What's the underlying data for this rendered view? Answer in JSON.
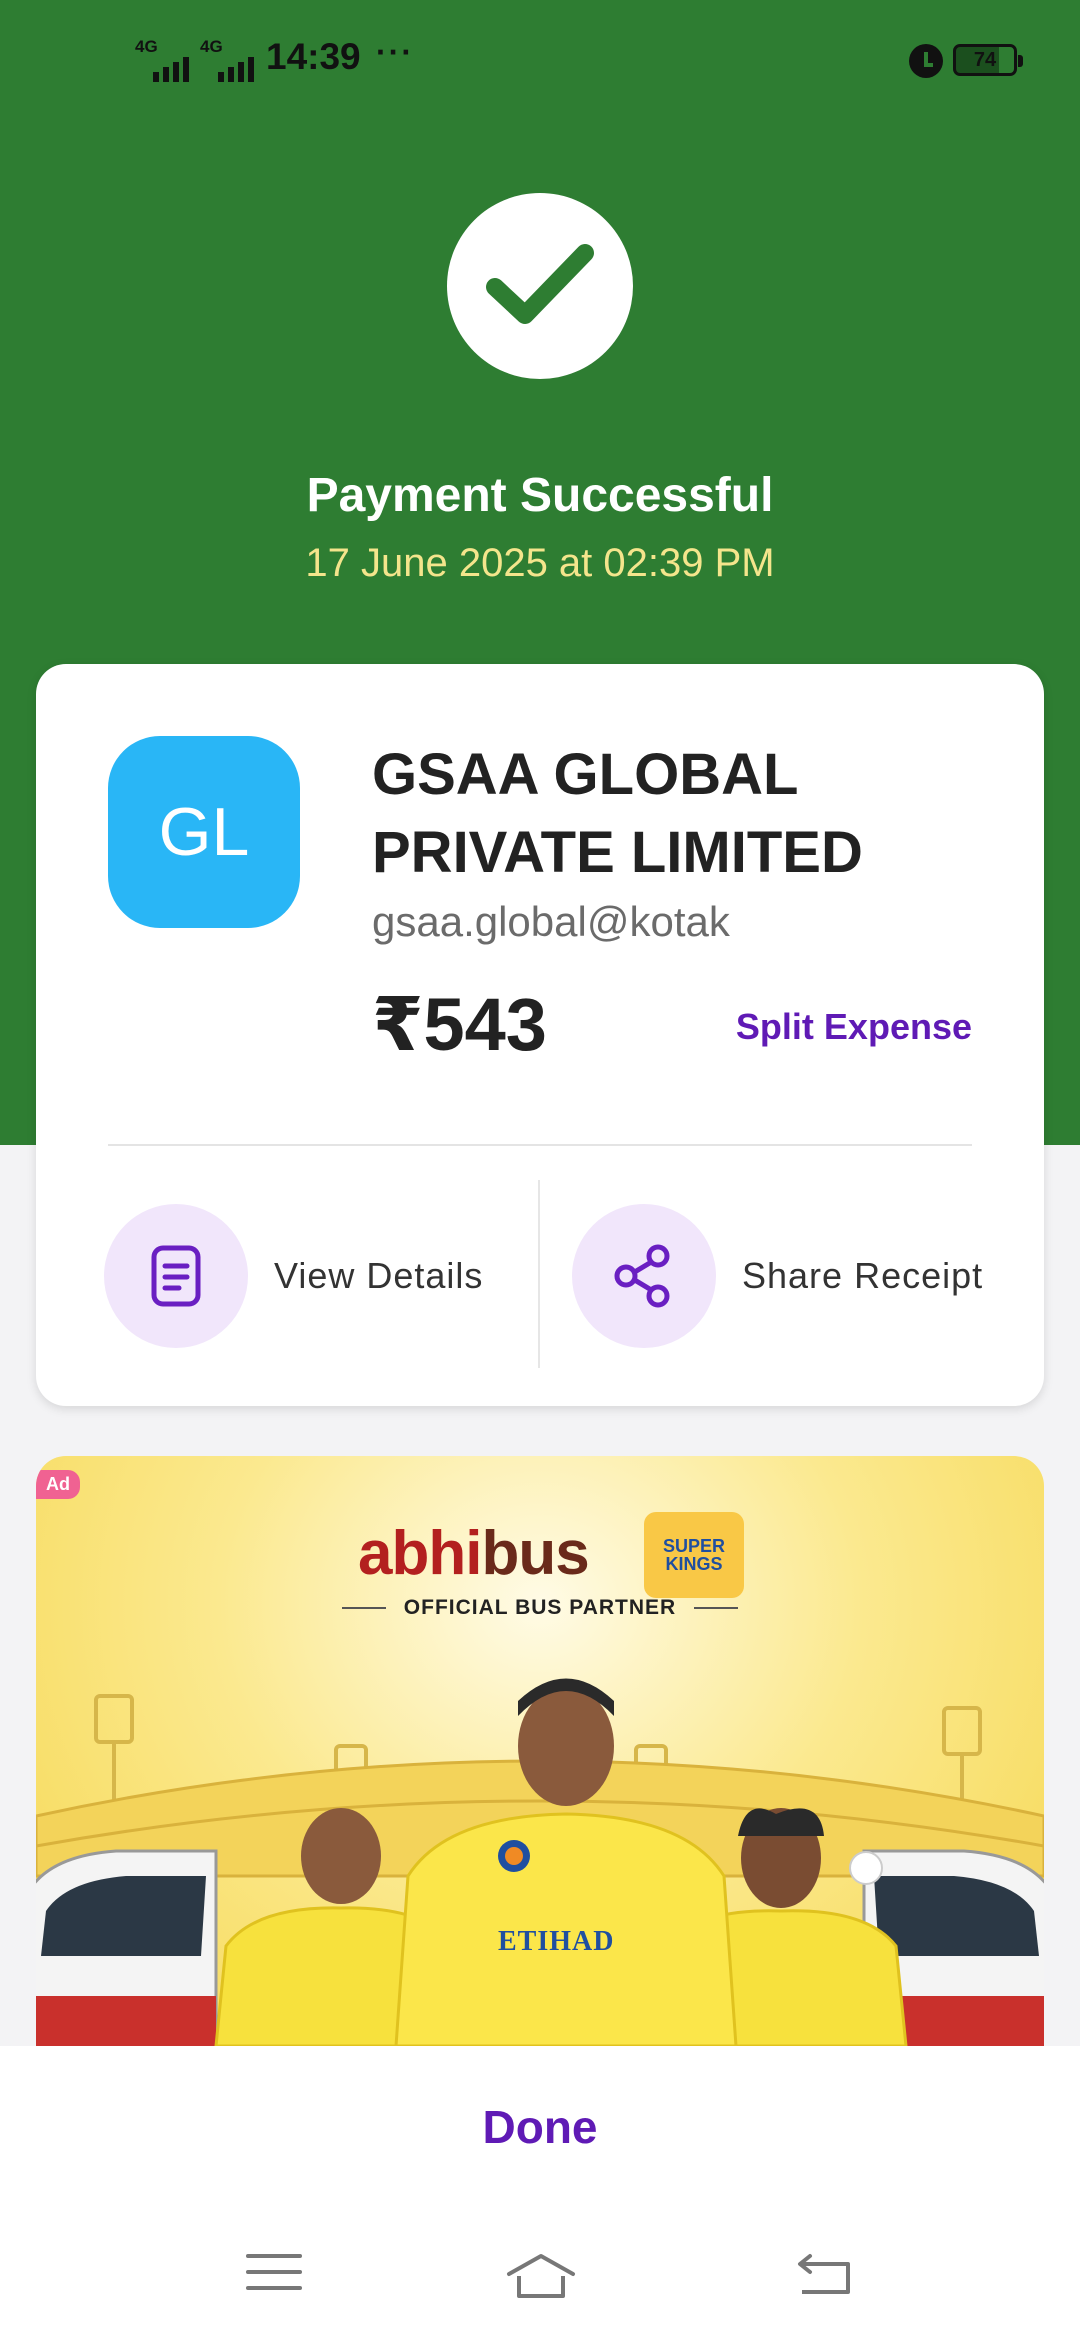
{
  "status_bar": {
    "network_1": "4G",
    "network_2": "4G",
    "time": "14:39",
    "more": "···",
    "battery": "74"
  },
  "header": {
    "title": "Payment Successful",
    "datetime": "17 June 2025 at 02:39 PM"
  },
  "payee": {
    "initials": "GL",
    "name": "GSAA GLOBAL PRIVATE LIMITED",
    "upi_id": "gsaa.global@kotak",
    "amount": "₹543",
    "split_label": "Split Expense"
  },
  "actions": {
    "view_details": "View Details",
    "share_receipt": "Share Receipt"
  },
  "ad": {
    "badge": "Ad",
    "brand_part1": "abhi",
    "brand_part2": "bus",
    "partner_logo_text": "SUPER KINGS",
    "tagline": "OFFICIAL BUS PARTNER",
    "jersey_text": "ETIHAD"
  },
  "footer": {
    "done_label": "Done"
  },
  "colors": {
    "header_green": "#2e7d32",
    "accent_purple": "#5f1ab5",
    "avatar_blue": "#29b6f6",
    "date_yellow": "#f4e58c"
  }
}
